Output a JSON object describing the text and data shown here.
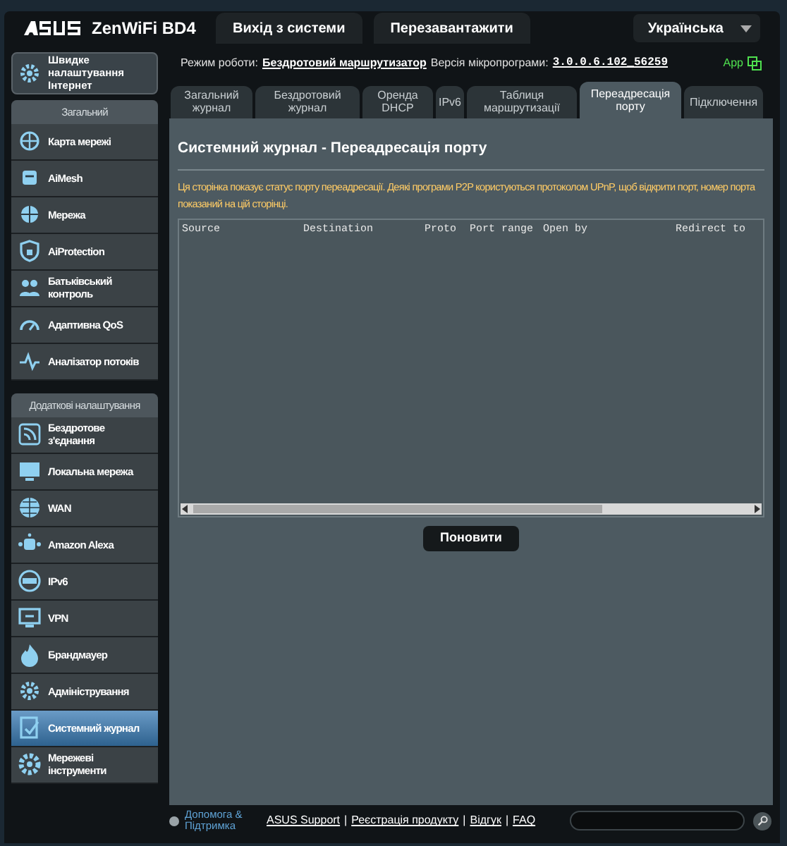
{
  "header": {
    "brand": "ZenWiFi BD4",
    "buttons": [
      "Вихід з системи",
      "Перезавантажити"
    ],
    "language": "Українська"
  },
  "status": {
    "mode_label": "Режим роботи:",
    "mode": "Бездротовий маршрутизатор",
    "firmware_label": "Версія мікропрограми:",
    "firmware": "3.0.0.6.102_56259",
    "app": "App"
  },
  "sidebar": {
    "quick_setup": "Швидке налаштування Інтернет",
    "sections": [
      {
        "title": "Загальний",
        "items": [
          {
            "label": "Карта мережі",
            "selected": false
          },
          {
            "label": "AiMesh",
            "selected": false
          },
          {
            "label": "Мережа",
            "selected": false
          },
          {
            "label": "AiProtection",
            "selected": false
          },
          {
            "label": "Батьківський контроль",
            "selected": false
          },
          {
            "label": "Адаптивна QoS",
            "selected": false
          },
          {
            "label": "Аналізатор потоків",
            "selected": false
          }
        ]
      },
      {
        "title": "Додаткові налаштування",
        "items": [
          {
            "label": "Бездротове з'єднання",
            "selected": false
          },
          {
            "label": "Локальна мережа",
            "selected": false
          },
          {
            "label": "WAN",
            "selected": false
          },
          {
            "label": "Amazon Alexa",
            "selected": false
          },
          {
            "label": "IPv6",
            "selected": false
          },
          {
            "label": "VPN",
            "selected": false
          },
          {
            "label": "Брандмауер",
            "selected": false
          },
          {
            "label": "Адміністрування",
            "selected": false
          },
          {
            "label": "Системний журнал",
            "selected": true
          },
          {
            "label": "Мережеві інструменти",
            "selected": false
          }
        ]
      }
    ]
  },
  "tabs": [
    {
      "label": "Загальний журнал",
      "selected": false
    },
    {
      "label": "Бездротовий журнал",
      "selected": false
    },
    {
      "label": "Оренда DHCP",
      "selected": false
    },
    {
      "label": "IPv6",
      "selected": false
    },
    {
      "label": "Таблиця маршрутизації",
      "selected": false
    },
    {
      "label": "Переадресація порту",
      "selected": true
    },
    {
      "label": "Підключення",
      "selected": false
    }
  ],
  "panel": {
    "title": "Системний журнал - Переадресація порту",
    "description": "Ця сторінка показує статус порту переадресації. Деякі програми P2P користуються протоколом UPnP, щоб відкрити порт, номер порта показаний на цій сторінці.",
    "columns": [
      "Source",
      "Destination",
      "Proto",
      "Port range",
      "Open by",
      "Redirect to"
    ],
    "button": "Поновити"
  },
  "footer": {
    "help": "Допомога & Підтримка",
    "links": [
      "ASUS Support",
      "Реєстрація продукту",
      "Відгук",
      "FAQ"
    ],
    "separator": "|"
  }
}
